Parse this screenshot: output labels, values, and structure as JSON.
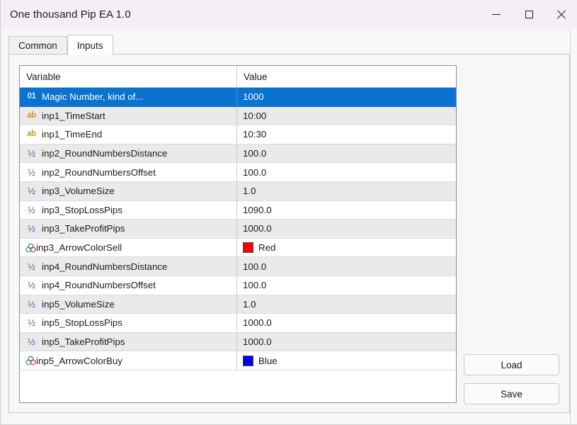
{
  "window": {
    "title": "One thousand Pip EA  1.0",
    "controls": [
      {
        "name": "minimize-button",
        "icon": "minimize-icon",
        "label": "Minimize"
      },
      {
        "name": "maximize-button",
        "icon": "maximize-icon",
        "label": "Maximize"
      },
      {
        "name": "close-button",
        "icon": "close-icon",
        "label": "Close"
      }
    ]
  },
  "tabs": [
    {
      "label": "Common",
      "active": false
    },
    {
      "label": "Inputs",
      "active": true
    }
  ],
  "grid": {
    "columns": [
      "Variable",
      "Value"
    ],
    "rows": [
      {
        "icon": "integer-type-icon",
        "icon_text": "01",
        "type": "int",
        "variable": "Magic Number, kind of...",
        "value": "1000",
        "selected": true
      },
      {
        "icon": "string-type-icon",
        "icon_text": "ab",
        "type": "str",
        "variable": "inp1_TimeStart",
        "value": "10:00",
        "selected": false
      },
      {
        "icon": "string-type-icon",
        "icon_text": "ab",
        "type": "str",
        "variable": "inp1_TimeEnd",
        "value": "10:30",
        "selected": false
      },
      {
        "icon": "double-type-icon",
        "icon_text": "½",
        "type": "dbl",
        "variable": "inp2_RoundNumbersDistance",
        "value": "100.0",
        "selected": false
      },
      {
        "icon": "double-type-icon",
        "icon_text": "½",
        "type": "dbl",
        "variable": "inp2_RoundNumbersOffset",
        "value": "100.0",
        "selected": false
      },
      {
        "icon": "double-type-icon",
        "icon_text": "½",
        "type": "dbl",
        "variable": "inp3_VolumeSize",
        "value": "1.0",
        "selected": false
      },
      {
        "icon": "double-type-icon",
        "icon_text": "½",
        "type": "dbl",
        "variable": "inp3_StopLossPips",
        "value": "1090.0",
        "selected": false
      },
      {
        "icon": "double-type-icon",
        "icon_text": "½",
        "type": "dbl",
        "variable": "inp3_TakeProfitPips",
        "value": "1000.0",
        "selected": false
      },
      {
        "icon": "color-type-icon",
        "icon_text": "",
        "type": "color",
        "variable": "inp3_ArrowColorSell",
        "value": "Red",
        "swatch": "#FF0000",
        "selected": false
      },
      {
        "icon": "double-type-icon",
        "icon_text": "½",
        "type": "dbl",
        "variable": "inp4_RoundNumbersDistance",
        "value": "100.0",
        "selected": false
      },
      {
        "icon": "double-type-icon",
        "icon_text": "½",
        "type": "dbl",
        "variable": "inp4_RoundNumbersOffset",
        "value": "100.0",
        "selected": false
      },
      {
        "icon": "double-type-icon",
        "icon_text": "½",
        "type": "dbl",
        "variable": "inp5_VolumeSize",
        "value": "1.0",
        "selected": false
      },
      {
        "icon": "double-type-icon",
        "icon_text": "½",
        "type": "dbl",
        "variable": "inp5_StopLossPips",
        "value": "1000.0",
        "selected": false
      },
      {
        "icon": "double-type-icon",
        "icon_text": "½",
        "type": "dbl",
        "variable": "inp5_TakeProfitPips",
        "value": "1000.0",
        "selected": false
      },
      {
        "icon": "color-type-icon",
        "icon_text": "",
        "type": "color",
        "variable": "inp5_ArrowColorBuy",
        "value": "Blue",
        "swatch": "#0000EE",
        "selected": false
      }
    ]
  },
  "buttons": {
    "load": "Load",
    "save": "Save"
  },
  "colors": {
    "selection": "#0a72cf",
    "titlebar": "#f4eff4",
    "panel": "#f7f7f7",
    "row_alt": "#eaeaea",
    "int_icon": "#2f6fb5",
    "str_icon": "#c79a33"
  }
}
